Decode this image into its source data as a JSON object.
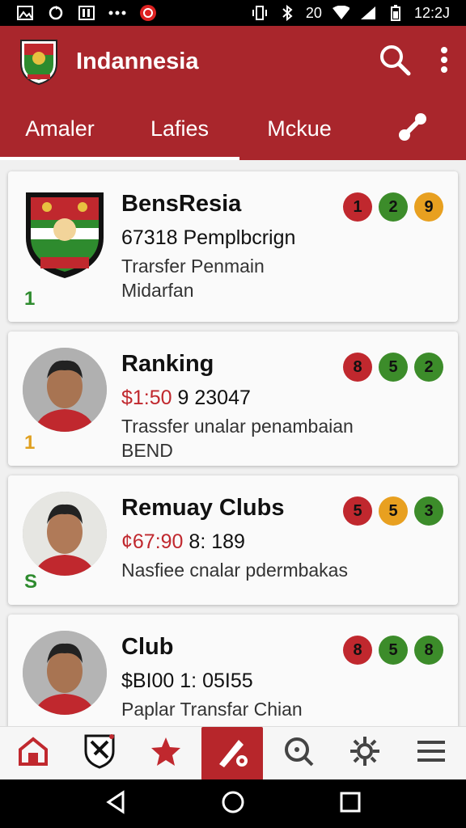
{
  "status": {
    "time": "12:2J",
    "network": "20"
  },
  "app": {
    "title": "Indannesia"
  },
  "tabs": [
    {
      "label": "Amaler"
    },
    {
      "label": "Lafies"
    },
    {
      "label": "Mckue"
    }
  ],
  "cards": [
    {
      "name": "BensResia",
      "line1_price": "",
      "line1": "67318 Pemplbcrign",
      "line2": "Trarsfer Penmain",
      "line3": "Midarfan",
      "rank": "1",
      "rank_color": "#2e8b2e",
      "badges": [
        {
          "value": "1",
          "color": "#c0282e"
        },
        {
          "value": "2",
          "color": "#3c8c2a"
        },
        {
          "value": "9",
          "color": "#e8a020"
        }
      ]
    },
    {
      "name": "Ranking",
      "line1_price": "$1:50",
      "line1": " 9 23047",
      "line2": "Trassfer unalar penambaian",
      "line3": "BEND",
      "rank": "1",
      "rank_color": "#e0a020",
      "badges": [
        {
          "value": "8",
          "color": "#c0282e"
        },
        {
          "value": "5",
          "color": "#3c8c2a"
        },
        {
          "value": "2",
          "color": "#3c8c2a"
        }
      ]
    },
    {
      "name": "Remuay Clubs",
      "line1_price": "¢67:90",
      "line1": " 8: 189",
      "line2": "Nasfiee cnalar pdermbakas",
      "line3": "",
      "rank": "S",
      "rank_color": "#2e8b2e",
      "badges": [
        {
          "value": "5",
          "color": "#c0282e"
        },
        {
          "value": "5",
          "color": "#e8a020"
        },
        {
          "value": "3",
          "color": "#3c8c2a"
        }
      ]
    },
    {
      "name": "Club",
      "line1_price": "",
      "line1": "$BI00 1: 05I55",
      "line2": "Paplar Transfar Chian",
      "line3": "",
      "rank": "",
      "rank_color": "#e0a020",
      "badges": [
        {
          "value": "8",
          "color": "#c0282e"
        },
        {
          "value": "5",
          "color": "#3c8c2a"
        },
        {
          "value": "8",
          "color": "#3c8c2a"
        }
      ]
    }
  ],
  "colors": {
    "primary": "#a9262c",
    "accent": "#b7262b"
  },
  "icons": {
    "status": [
      "gallery-icon",
      "sync-icon",
      "news-icon",
      "more-dots-icon",
      "notification-icon",
      "vibrate-icon",
      "bluetooth-icon",
      "wifi-icon",
      "signal-icon",
      "battery-icon"
    ],
    "bottom_nav": [
      "home-icon",
      "club-crest-icon",
      "star-icon",
      "transfer-icon",
      "search-icon",
      "settings-icon",
      "menu-icon"
    ]
  }
}
